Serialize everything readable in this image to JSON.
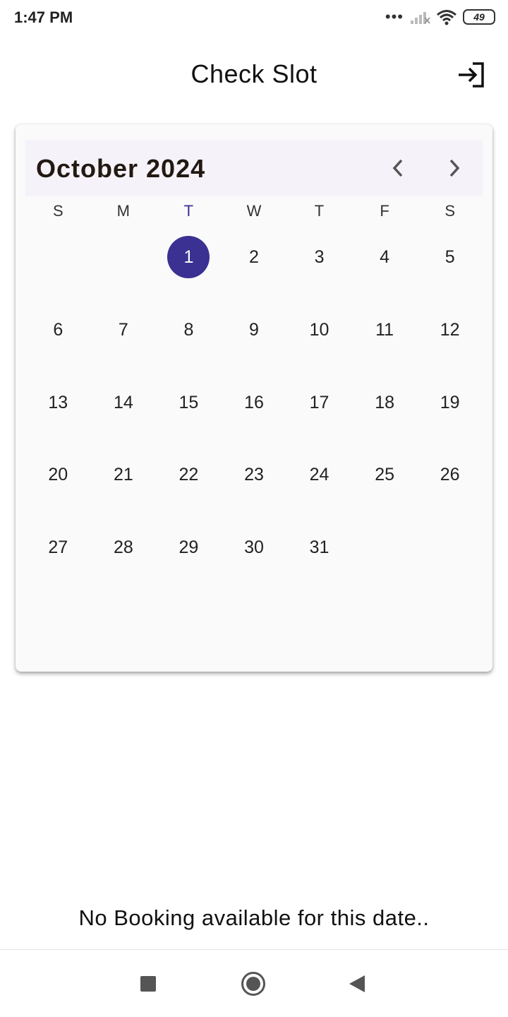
{
  "status_bar": {
    "time": "1:47 PM",
    "battery": "49",
    "icons": [
      "more-dots-icon",
      "signal-icon",
      "wifi-icon",
      "battery-icon"
    ]
  },
  "header": {
    "title": "Check Slot",
    "action_icon": "logout-icon"
  },
  "calendar": {
    "month_label": "October 2024",
    "prev_icon": "chevron-left-icon",
    "next_icon": "chevron-right-icon",
    "weekdays": [
      "S",
      "M",
      "T",
      "W",
      "T",
      "F",
      "S"
    ],
    "today_weekday_index": 2,
    "selected_day": "1",
    "leading_blank_days": 2,
    "days": [
      "1",
      "2",
      "3",
      "4",
      "5",
      "6",
      "7",
      "8",
      "9",
      "10",
      "11",
      "12",
      "13",
      "14",
      "15",
      "16",
      "17",
      "18",
      "19",
      "20",
      "21",
      "22",
      "23",
      "24",
      "25",
      "26",
      "27",
      "28",
      "29",
      "30",
      "31"
    ],
    "accent_color": "#3b3192"
  },
  "main": {
    "empty_message": "No Booking available for this date.."
  },
  "nav_bar": {
    "buttons": [
      "recents-button",
      "home-button",
      "back-button"
    ]
  }
}
